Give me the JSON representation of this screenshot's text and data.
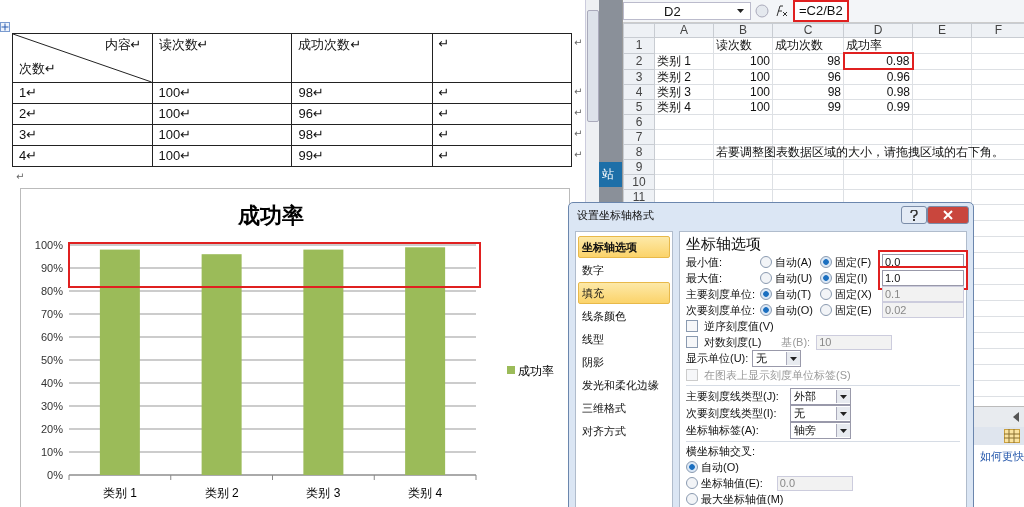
{
  "word": {
    "table": {
      "header": {
        "top": "内容↵",
        "bottom": "次数↵",
        "columns": [
          "读次数↵",
          "成功次数↵",
          "↵"
        ],
        "end": "↵"
      },
      "rows": [
        {
          "cells": [
            "1↵",
            "100↵",
            "98↵",
            "↵"
          ],
          "end": "↵"
        },
        {
          "cells": [
            "2↵",
            "100↵",
            "96↵",
            "↵"
          ],
          "end": "↵"
        },
        {
          "cells": [
            "3↵",
            "100↵",
            "98↵",
            "↵"
          ],
          "end": "↵"
        },
        {
          "cells": [
            "4↵",
            "100↵",
            "99↵",
            "↵"
          ],
          "end": "↵"
        }
      ]
    },
    "after_table": "↵",
    "chart": {
      "highlighted": true,
      "chart_data": {
        "type": "bar",
        "title": "成功率",
        "categories": [
          "类别 1",
          "类别 2",
          "类别 3",
          "类别 4"
        ],
        "series": [
          {
            "name": "成功率",
            "color": "#9bbb59",
            "values": [
              0.98,
              0.96,
              0.98,
              0.99
            ]
          }
        ],
        "grid": true,
        "ylim": [
          0,
          1
        ],
        "yticks": [
          {
            "value": 0,
            "label": "0%"
          },
          {
            "value": 0.1,
            "label": "10%"
          },
          {
            "value": 0.2,
            "label": "20%"
          },
          {
            "value": 0.3,
            "label": "30%"
          },
          {
            "value": 0.4,
            "label": "40%"
          },
          {
            "value": 0.5,
            "label": "50%"
          },
          {
            "value": 0.6,
            "label": "60%"
          },
          {
            "value": 0.7,
            "label": "70%"
          },
          {
            "value": 0.8,
            "label": "80%"
          },
          {
            "value": 0.9,
            "label": "90%"
          },
          {
            "value": 1,
            "label": "100%"
          }
        ]
      }
    }
  },
  "side_strip": {
    "tile": "站"
  },
  "excel": {
    "name_box": "D2",
    "formula": "=C2/B2",
    "formula_highlighted": true,
    "columns": [
      "A",
      "B",
      "C",
      "D",
      "E",
      "F"
    ],
    "rows": [
      {
        "header": "1",
        "cells": [
          null,
          {
            "text": "读次数",
            "kind": "text",
            "highlighted": false
          },
          {
            "text": "成功次数",
            "kind": "text",
            "highlighted": false
          },
          {
            "text": "成功率",
            "kind": "text",
            "highlighted": false
          },
          null,
          null
        ]
      },
      {
        "header": "2",
        "cells": [
          {
            "text": "类别 1",
            "kind": "text",
            "highlighted": false
          },
          {
            "text": "100",
            "kind": "number",
            "highlighted": false
          },
          {
            "text": "98",
            "kind": "number",
            "highlighted": false
          },
          {
            "text": "0.98",
            "kind": "number",
            "highlighted": true
          },
          null,
          null
        ]
      },
      {
        "header": "3",
        "cells": [
          {
            "text": "类别 2",
            "kind": "text",
            "highlighted": false
          },
          {
            "text": "100",
            "kind": "number",
            "highlighted": false
          },
          {
            "text": "96",
            "kind": "number",
            "highlighted": false
          },
          {
            "text": "0.96",
            "kind": "number",
            "highlighted": false
          },
          null,
          null
        ]
      },
      {
        "header": "4",
        "cells": [
          {
            "text": "类别 3",
            "kind": "text",
            "highlighted": false
          },
          {
            "text": "100",
            "kind": "number",
            "highlighted": false
          },
          {
            "text": "98",
            "kind": "number",
            "highlighted": false
          },
          {
            "text": "0.98",
            "kind": "number",
            "highlighted": false
          },
          null,
          null
        ]
      },
      {
        "header": "5",
        "cells": [
          {
            "text": "类别 4",
            "kind": "text",
            "highlighted": false
          },
          {
            "text": "100",
            "kind": "number",
            "highlighted": false
          },
          {
            "text": "99",
            "kind": "number",
            "highlighted": false
          },
          {
            "text": "0.99",
            "kind": "number",
            "highlighted": false
          },
          null,
          null
        ]
      },
      {
        "header": "6",
        "cells": [
          null,
          null,
          null,
          null,
          null,
          null
        ]
      },
      {
        "header": "7",
        "cells": [
          null,
          null,
          null,
          null,
          null,
          null
        ]
      },
      {
        "header": "8",
        "cells": [
          null,
          {
            "text": "若要调整图表数据区域的大小，请拖拽区域的右下角。",
            "kind": "note",
            "highlighted": false
          },
          null,
          null,
          null,
          null
        ]
      },
      {
        "header": "9",
        "cells": [
          null,
          null,
          null,
          null,
          null,
          null
        ]
      },
      {
        "header": "10",
        "cells": [
          null,
          null,
          null,
          null,
          null,
          null
        ]
      },
      {
        "header": "11",
        "cells": [
          null,
          null,
          null,
          null,
          null,
          null
        ]
      }
    ],
    "help_link": "如何更快"
  },
  "dialog": {
    "title": "设置坐标轴格式",
    "nav": [
      {
        "label": "坐标轴选项",
        "selected": true,
        "highlighted": true
      },
      {
        "label": "数字",
        "selected": false,
        "highlighted": false
      },
      {
        "label": "填充",
        "selected": false,
        "highlighted": true
      },
      {
        "label": "线条颜色",
        "selected": false,
        "highlighted": false
      },
      {
        "label": "线型",
        "selected": false,
        "highlighted": false
      },
      {
        "label": "阴影",
        "selected": false,
        "highlighted": false
      },
      {
        "label": "发光和柔化边缘",
        "selected": false,
        "highlighted": false
      },
      {
        "label": "三维格式",
        "selected": false,
        "highlighted": false
      },
      {
        "label": "对齐方式",
        "selected": false,
        "highlighted": false
      }
    ],
    "heading": "坐标轴选项",
    "scale_rows": [
      {
        "label": "最小值:",
        "choices": [
          {
            "label": "自动(A)",
            "selected": false
          },
          {
            "label": "固定(F)",
            "selected": true
          }
        ],
        "value": "0.0",
        "disabled": false,
        "highlighted": true
      },
      {
        "label": "最大值:",
        "choices": [
          {
            "label": "自动(U)",
            "selected": false
          },
          {
            "label": "固定(I)",
            "selected": true
          }
        ],
        "value": "1.0",
        "disabled": false,
        "highlighted": true
      },
      {
        "label": "主要刻度单位:",
        "choices": [
          {
            "label": "自动(T)",
            "selected": true
          },
          {
            "label": "固定(X)",
            "selected": false
          }
        ],
        "value": "0.1",
        "disabled": true,
        "highlighted": false
      },
      {
        "label": "次要刻度单位:",
        "choices": [
          {
            "label": "自动(O)",
            "selected": true
          },
          {
            "label": "固定(E)",
            "selected": false
          }
        ],
        "value": "0.02",
        "disabled": true,
        "highlighted": false
      }
    ],
    "reverse": {
      "label": "逆序刻度值(V)",
      "checked": false,
      "disabled": false
    },
    "log": {
      "label": "对数刻度(L)",
      "checked": false,
      "disabled": false,
      "base_label": "基(B):",
      "base_value": "10",
      "base_disabled": true
    },
    "display_unit": {
      "label": "显示单位(U):",
      "value": "无"
    },
    "show_unit_label": {
      "label": "在图表上显示刻度单位标签(S)",
      "checked": false,
      "disabled": true
    },
    "selects": [
      {
        "label": "主要刻度线类型(J):",
        "value": "外部"
      },
      {
        "label": "次要刻度线类型(I):",
        "value": "无"
      },
      {
        "label": "坐标轴标签(A):",
        "value": "轴旁"
      }
    ],
    "cross": {
      "label": "横坐标轴交叉:",
      "options": [
        {
          "label": "自动(O)",
          "selected": true
        },
        {
          "label": "坐标轴值(E):",
          "selected": false,
          "value": "0.0"
        },
        {
          "label": "最大坐标轴值(M)",
          "selected": false
        }
      ]
    }
  }
}
